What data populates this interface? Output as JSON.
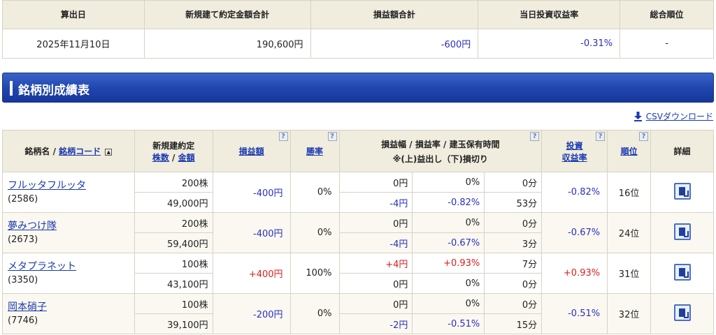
{
  "summary": {
    "headers": [
      "算出日",
      "新規建て約定金額合計",
      "損益額合計",
      "当日投資収益率",
      "総合順位"
    ],
    "values": [
      "2025年11月10日",
      "190,600円",
      "-600円",
      "-0.31%",
      "-"
    ]
  },
  "section": {
    "title": "銘柄別成績表"
  },
  "csv": {
    "label": "CSVダウンロード",
    "icon": "download-icon"
  },
  "table": {
    "h_name": "銘柄名 /",
    "h_code": "銘柄コード",
    "h_sort": "▲",
    "h_newtrade": "新規建約定",
    "h_shares": "株数",
    "h_slash": "/",
    "h_amount": "金額",
    "h_pl": "損益額",
    "h_win": "勝率",
    "h_range1": "損益幅 / 損益率 / 建玉保有時間",
    "h_range2": "※(上)益出し（下)損切り",
    "h_roi1": "投資",
    "h_roi2": "収益率",
    "h_rank": "順位",
    "h_detail": "詳細",
    "help": "?",
    "rows": [
      {
        "name": "フルッタフルッタ",
        "code": "(2586)",
        "shares": "200株",
        "amount": "49,000円",
        "pl": "-400円",
        "win": "0%",
        "up_amt": "0円",
        "up_rate": "0%",
        "up_time": "0分",
        "dn_amt": "-4円",
        "dn_rate": "-0.82%",
        "dn_time": "53分",
        "roi": "-0.82%",
        "rank": "16位"
      },
      {
        "name": "夢みつけ隊",
        "code": "(2673)",
        "shares": "200株",
        "amount": "59,400円",
        "pl": "-400円",
        "win": "0%",
        "up_amt": "0円",
        "up_rate": "0%",
        "up_time": "0分",
        "dn_amt": "-4円",
        "dn_rate": "-0.67%",
        "dn_time": "3分",
        "roi": "-0.67%",
        "rank": "24位"
      },
      {
        "name": "メタプラネット",
        "code": "(3350)",
        "shares": "100株",
        "amount": "43,100円",
        "pl": "+400円",
        "win": "100%",
        "up_amt": "+4円",
        "up_rate": "+0.93%",
        "up_time": "7分",
        "dn_amt": "0円",
        "dn_rate": "0%",
        "dn_time": "0分",
        "roi": "+0.93%",
        "rank": "31位"
      },
      {
        "name": "岡本硝子",
        "code": "(7746)",
        "shares": "100株",
        "amount": "39,100円",
        "pl": "-200円",
        "win": "0%",
        "up_amt": "0円",
        "up_rate": "0%",
        "up_time": "0分",
        "dn_amt": "-2円",
        "dn_rate": "-0.51%",
        "dn_time": "15分",
        "roi": "-0.51%",
        "rank": "32位"
      }
    ]
  },
  "colors": {
    "positive": "#d9201f",
    "negative": "#2b2fbf",
    "header_bg": "#f1edde",
    "bar": "#1f45ad"
  }
}
